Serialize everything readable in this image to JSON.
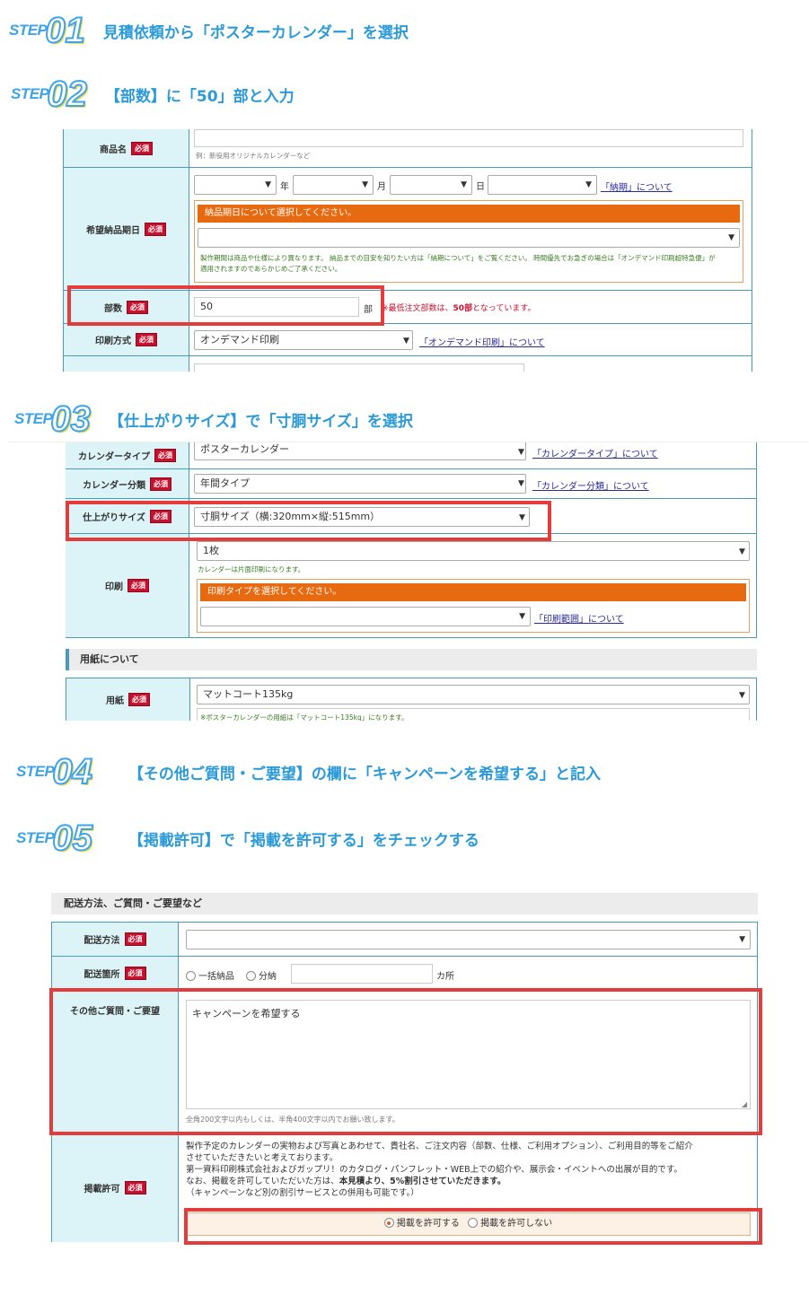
{
  "steps": [
    {
      "word": "STEP",
      "num": "01",
      "title": "見積依頼から「ポスターカレンダー」を選択"
    },
    {
      "word": "STEP",
      "num": "02",
      "title": "【部数】に「50」部と入力"
    },
    {
      "word": "STEP",
      "num": "03",
      "title": "【仕上がりサイズ】で「寸胴サイズ」を選択"
    },
    {
      "word": "STEP",
      "num": "04",
      "title": "【その他ご質問・ご要望】の欄に「キャンペーンを希望する」と記入"
    },
    {
      "word": "STEP",
      "num": "05",
      "title": "【掲載許可】で「掲載を許可する」をチェックする"
    }
  ],
  "required_badge": "必須",
  "form1": {
    "product_label": "商品名",
    "product_example": "例：新役用オリジナルカレンダーなど",
    "date_label": "希望納品期日",
    "year": "年",
    "month": "月",
    "day": "日",
    "delivery_link": "「納期」について",
    "delivery_bar": "納品期日について選択してください。",
    "delivery_note1": "製作期間は商品や仕様により異なります。 納品までの目安を知りたい方は「納期について」をご覧ください。 時間優先でお急ぎの場合は「オンデマンド印刷超特急便」が",
    "delivery_note2": "適用されますのであらかじめご了承ください。",
    "qty_label": "部数",
    "qty_value": "50",
    "qty_unit": "部",
    "qty_note_prefix": "※最低注文部数は、",
    "qty_note_bold": "50部",
    "qty_note_suffix": "となっています。",
    "print_method_label": "印刷方式",
    "print_method_value": "オンデマンド印刷",
    "print_method_link": "「オンデマンド印刷」について"
  },
  "form2": {
    "type_label": "カレンダータイプ",
    "type_value": "ポスターカレンダー",
    "type_link": "「カレンダータイプ」について",
    "class_label": "カレンダー分類",
    "class_value": "年間タイプ",
    "class_link": "「カレンダー分類」について",
    "size_label": "仕上がりサイズ",
    "size_value": "寸胴サイズ（横:320mm×縦:515mm）",
    "print_label": "印刷",
    "print_value": "1枚",
    "print_note": "カレンダーは片面印刷になります。",
    "print_bar": "印刷タイプを選択してください。",
    "print_link": "「印刷範囲」について",
    "paper_section": "用紙について",
    "paper_label": "用紙",
    "paper_value": "マットコート135kg",
    "paper_note": "※ポスターカレンダーの用紙は「マットコート135kg」になります。"
  },
  "form3": {
    "section": "配送方法、ご質問・ご要望など",
    "ship_label": "配送方法",
    "dest_label": "配送箇所",
    "dest_opt1": "一括納品",
    "dest_opt2": "分納",
    "dest_unit": "カ所",
    "q_label": "その他ご質問・ご要望",
    "q_value": "キャンペーンを希望する",
    "q_note": "全角200文字以内もしくは、半角400文字以内でお願い致します。",
    "perm_label": "掲載許可",
    "perm_text1": "製作予定のカレンダーの実物および写真とあわせて、貴社名、ご注文内容（部数、仕様、ご利用オプション）、ご利用目的等をご紹介",
    "perm_text2": "させていただきたいと考えております。",
    "perm_text3": "第一資料印刷株式会社およびガップリ！のカタログ・パンフレット・WEB上での紹介や、展示会・イベントへの出展が目的です。",
    "perm_text4_prefix": "なお、掲載を許可していただいた方は、",
    "perm_text4_bold": "本見積より、5%割引させていただきます。",
    "perm_text5": "（キャンペーンなど別の割引サービスとの併用も可能です。）",
    "perm_opt1": "掲載を許可する",
    "perm_opt2": "掲載を許可しない"
  },
  "colors": {
    "accent": "#3ea3e8",
    "required": "#c8102e",
    "highlight": "#e43b3b",
    "orange": "#e86a10",
    "label_bg": "#dcf4f7"
  }
}
